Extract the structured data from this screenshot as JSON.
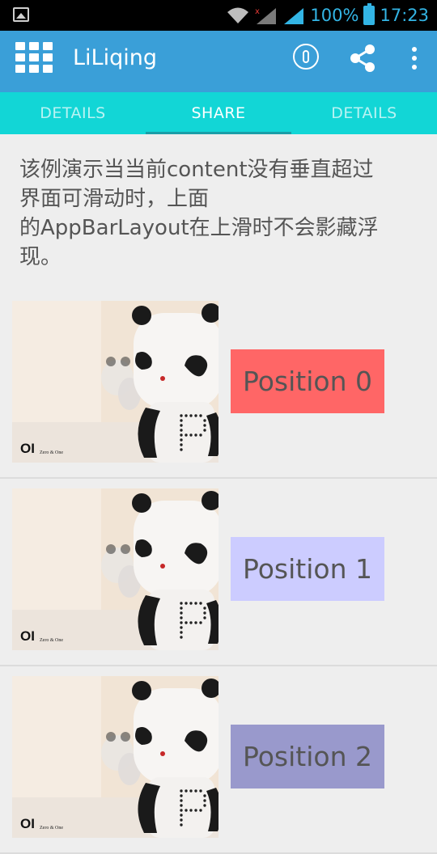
{
  "status_bar": {
    "battery_percent": "100%",
    "time": "17:23",
    "accent_color": "#33b5e5"
  },
  "app_bar": {
    "title": "LiLiqing",
    "icons": [
      "grid-menu-icon",
      "info-icon",
      "share-icon",
      "more-vertical-icon"
    ],
    "color": "#3a9fd8"
  },
  "tabs": [
    {
      "label": "DETAILS",
      "selected": false
    },
    {
      "label": "SHARE",
      "selected": true
    },
    {
      "label": "DETAILS",
      "selected": false
    }
  ],
  "description": {
    "lines": [
      "该例演示当当前content没有垂直超过",
      "界面可滑动时，上面",
      "的AppBarLayout在上滑时不会影藏浮",
      "现。"
    ]
  },
  "list": [
    {
      "label": "Position 0",
      "color": "#ff6666",
      "image_logo": "OI",
      "image_caption": "Zero & One"
    },
    {
      "label": "Position 1",
      "color": "#ccccff",
      "image_logo": "OI",
      "image_caption": "Zero & One"
    },
    {
      "label": "Position 2",
      "color": "#9999cc",
      "image_logo": "OI",
      "image_caption": "Zero & One"
    }
  ]
}
